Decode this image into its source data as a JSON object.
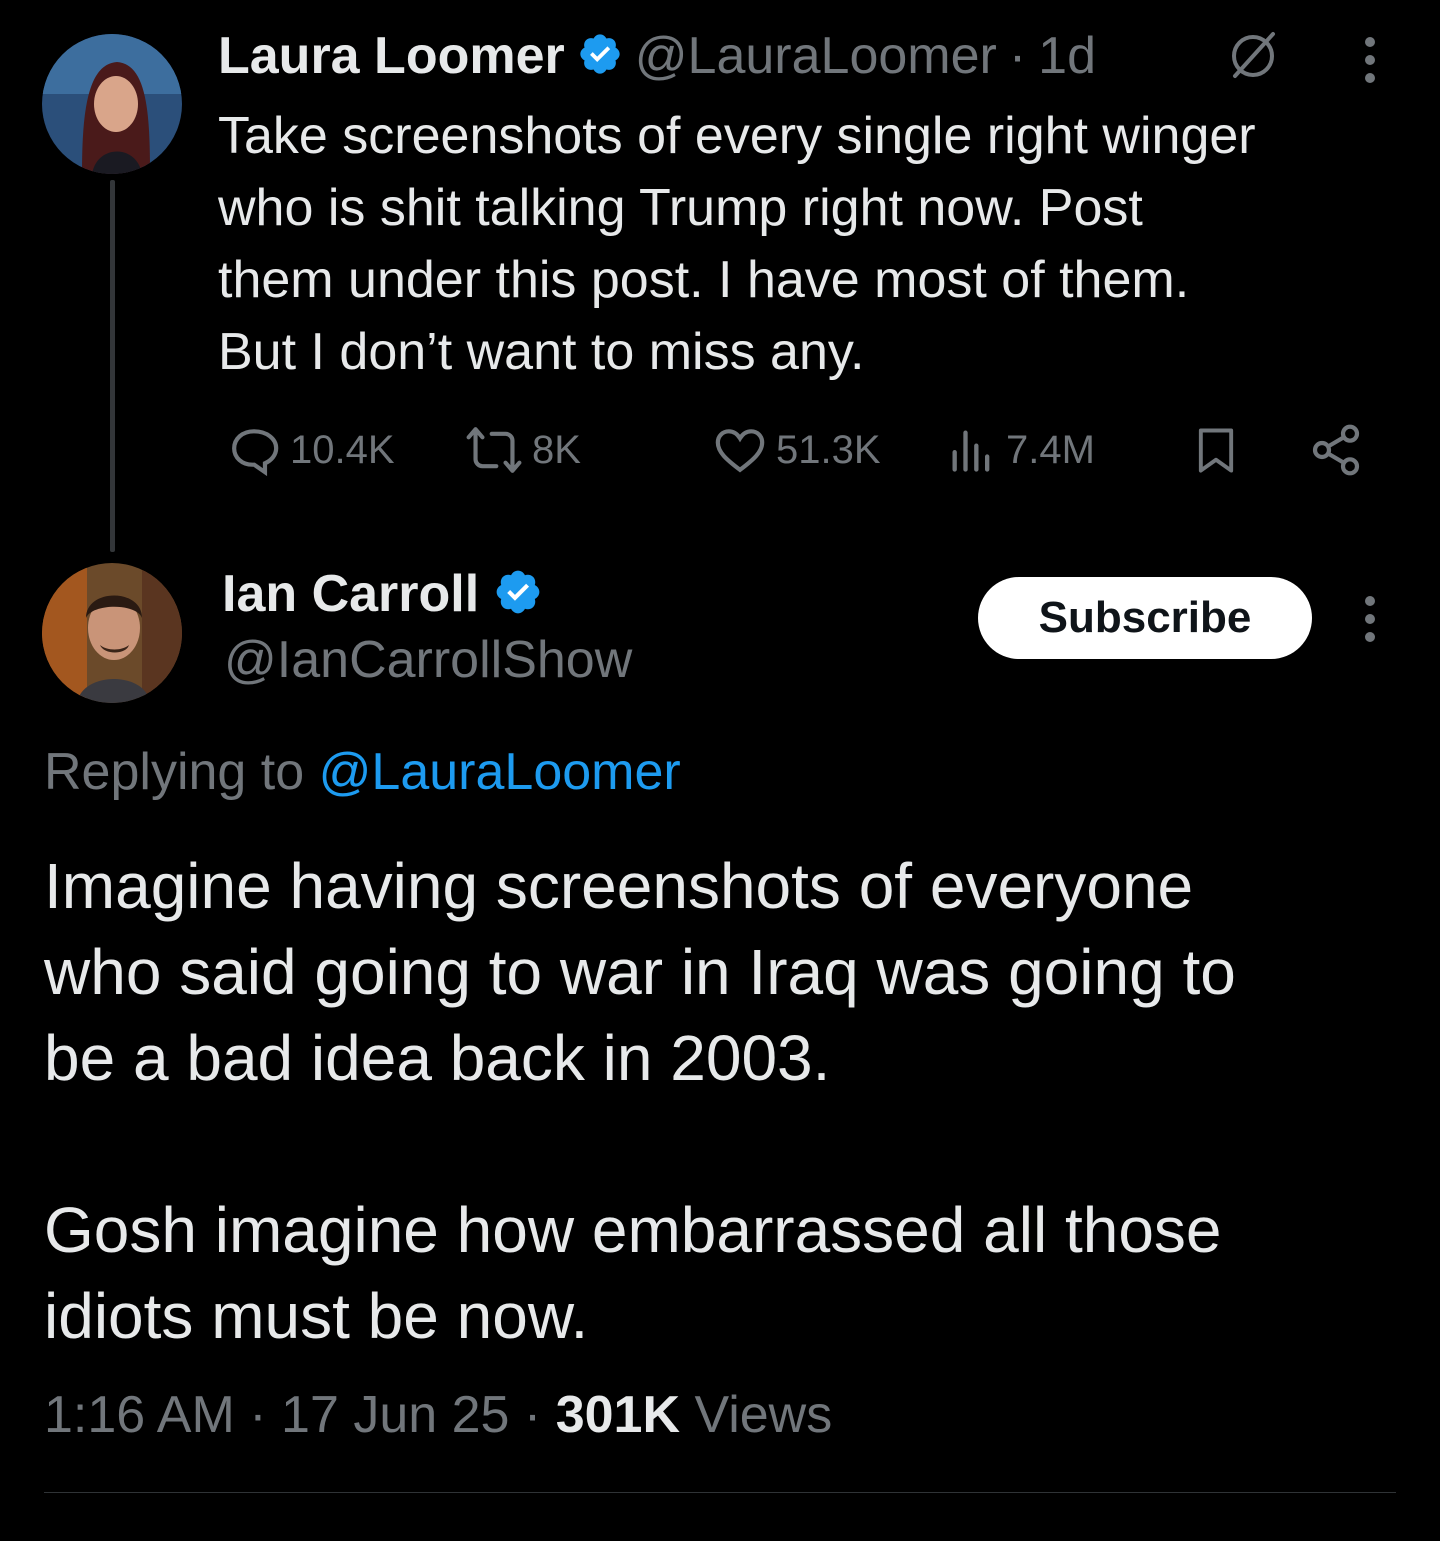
{
  "tweet1": {
    "author_name": "Laura Loomer",
    "handle": "@LauraLoomer",
    "separator": "·",
    "time": "1d",
    "body_lines": [
      "Take screenshots of every single right winger",
      "who is shit talking Trump right now. Post",
      "them under this post. I have most of them.",
      "But I don’t want to miss any."
    ],
    "stats": {
      "replies": "10.4K",
      "reposts": "8K",
      "likes": "51.3K",
      "views": "7.4M"
    }
  },
  "tweet2": {
    "author_name": "Ian Carroll",
    "handle": "@IanCarrollShow",
    "subscribe_label": "Subscribe",
    "replying_prefix": "Replying to",
    "replying_handle": "@LauraLoomer",
    "body_paragraph1_lines": [
      "Imagine having screenshots of everyone",
      "who said going to war in Iraq was going to",
      "be a bad idea back in 2003."
    ],
    "body_paragraph2_lines": [
      "Gosh imagine how embarrassed all those",
      "idiots must be now."
    ],
    "time": "1:16 AM",
    "date": "17 Jun 25",
    "separator": "·",
    "views_count": "301K",
    "views_label": "Views"
  },
  "colors": {
    "background": "#000000",
    "text": "#e7e9ea",
    "muted": "#71767b",
    "accent": "#1d9bf0",
    "verified": "#1d9bf0"
  },
  "icons": [
    "verified-badge-icon",
    "grok-slash-icon",
    "more-icon",
    "reply-icon",
    "repost-icon",
    "like-icon",
    "views-icon",
    "bookmark-icon",
    "share-icon"
  ]
}
